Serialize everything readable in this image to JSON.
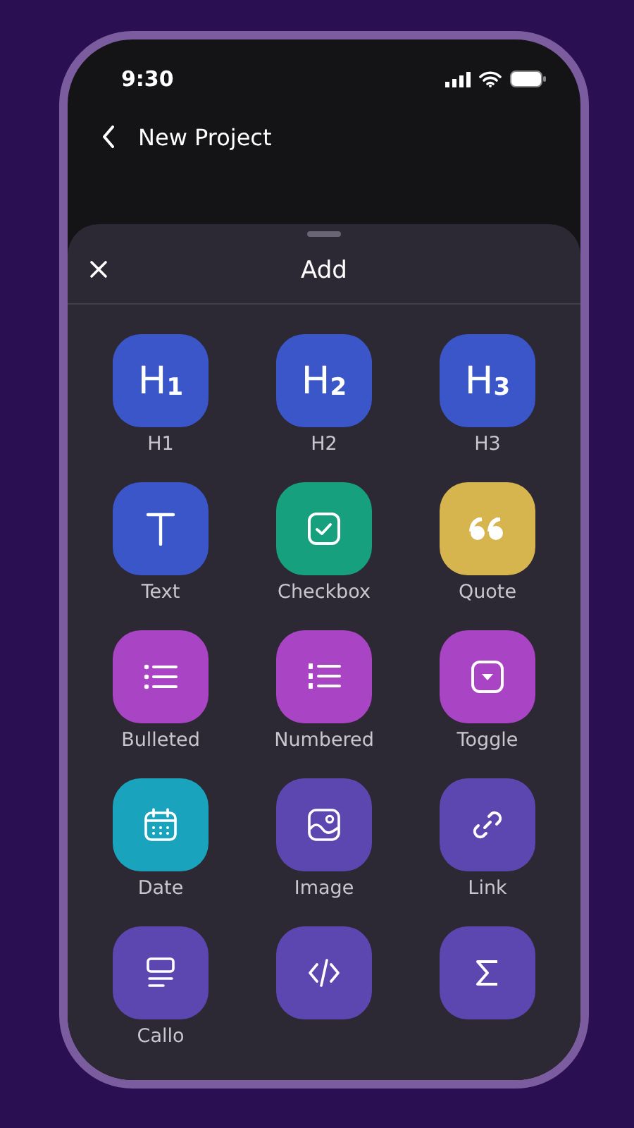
{
  "status_bar": {
    "time": "9:30"
  },
  "header": {
    "title": "New Project"
  },
  "sheet": {
    "title": "Add"
  },
  "blocks": [
    {
      "kind": "heading",
      "glyph": "H$_{1}$",
      "label": "H1",
      "color": "#3a56c8"
    },
    {
      "kind": "heading",
      "glyph": "H$_{2}$",
      "label": "H2",
      "color": "#3a56c8"
    },
    {
      "kind": "heading",
      "glyph": "H$_{3}$",
      "label": "H3",
      "color": "#3a56c8"
    },
    {
      "kind": "text",
      "label": "Text",
      "color": "#3a56c8"
    },
    {
      "kind": "checkbox",
      "label": "Checkbox",
      "color": "#17a07e"
    },
    {
      "kind": "quote",
      "label": "Quote",
      "color": "#d6b54e"
    },
    {
      "kind": "bulleted",
      "label": "Bulleted",
      "color": "#a944c4"
    },
    {
      "kind": "numbered",
      "label": "Numbered",
      "color": "#a944c4"
    },
    {
      "kind": "toggle",
      "label": "Toggle",
      "color": "#a944c4"
    },
    {
      "kind": "date",
      "label": "Date",
      "color": "#1aa3bd"
    },
    {
      "kind": "image",
      "label": "Image",
      "color": "#5c46b0"
    },
    {
      "kind": "link",
      "label": "Link",
      "color": "#5c46b0"
    },
    {
      "kind": "callout",
      "label": "Callo",
      "color": "#5c46b0"
    },
    {
      "kind": "code",
      "color": "#5c46b0"
    },
    {
      "kind": "sigma",
      "color": "#5c46b0"
    }
  ]
}
